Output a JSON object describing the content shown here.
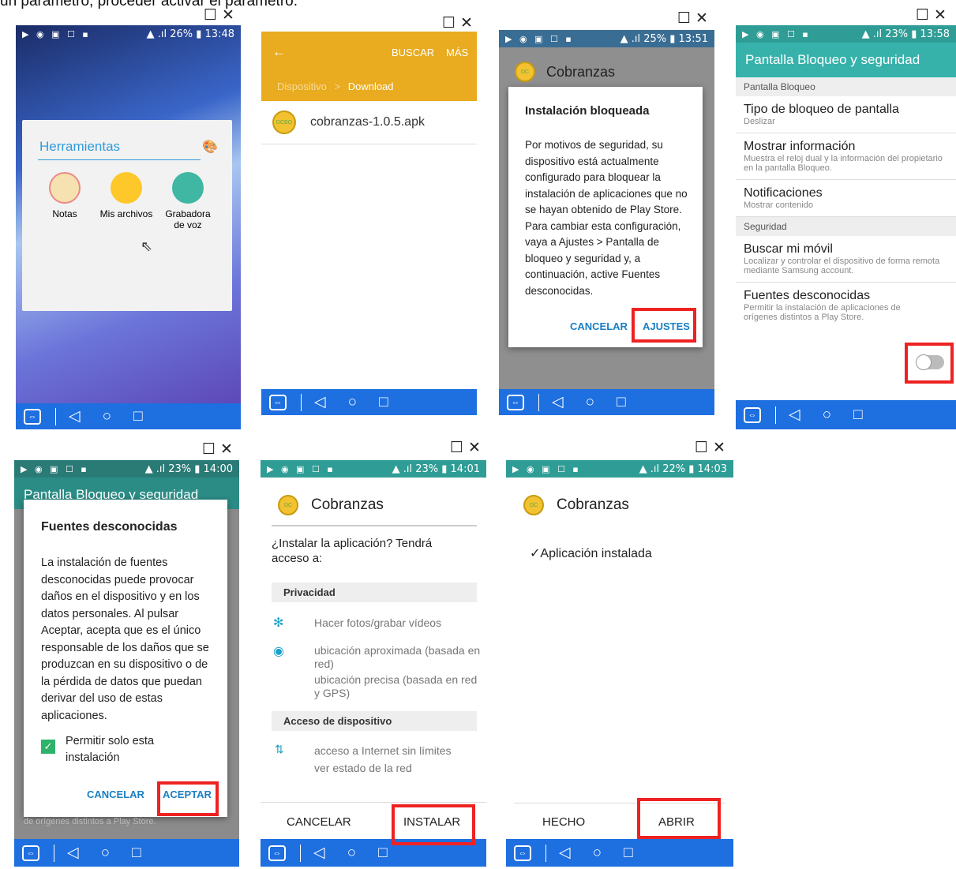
{
  "caption": "un parámetro, proceder activar el parámetro.",
  "status": {
    "p1": {
      "battery": "26%",
      "time": "13:48"
    },
    "p3": {
      "battery": "25%",
      "time": "13:51"
    },
    "p4": {
      "battery": "23%",
      "time": "13:58"
    },
    "p5": {
      "battery": "23%",
      "time": "14:00"
    },
    "p6": {
      "battery": "23%",
      "time": "14:01"
    },
    "p7": {
      "battery": "22%",
      "time": "14:03"
    }
  },
  "nav": {
    "back": "◁",
    "home": "○",
    "recent": "□"
  },
  "window_controls": "☐✕",
  "p1": {
    "folder_title": "Herramientas",
    "apps": [
      "Notas",
      "Mis archivos",
      "Grabadora de voz"
    ]
  },
  "p2": {
    "buscar": "BUSCAR",
    "mas": "MÁS",
    "breadcrumb_root": "Dispositivo",
    "breadcrumb_sep": ">",
    "breadcrumb_folder": "Download",
    "file": "cobranzas-1.0.5.apk"
  },
  "p3": {
    "app_name": "Cobranzas",
    "dialog_title": "Instalación bloqueada",
    "dialog_body": "Por motivos de seguridad, su dispositivo está actualmente configurado para bloquear la instalación de aplicaciones que no se hayan obtenido de Play Store. Para cambiar esta configuración, vaya a Ajustes > Pantalla de bloqueo y seguridad y, a continuación, active Fuentes desconocidas.",
    "cancel": "CANCELAR",
    "settings": "AJUSTES"
  },
  "p4": {
    "title": "Pantalla Bloqueo y seguridad",
    "section1": "Pantalla Bloqueo",
    "items": [
      {
        "title": "Tipo de bloqueo de pantalla",
        "sub": "Deslizar"
      },
      {
        "title": "Mostrar información",
        "sub": "Muestra el reloj dual y la información del propietario en la pantalla Bloqueo."
      },
      {
        "title": "Notificaciones",
        "sub": "Mostrar contenido"
      }
    ],
    "section2": "Seguridad",
    "items2": [
      {
        "title": "Buscar mi móvil",
        "sub": "Localizar y controlar el dispositivo de forma remota mediante Samsung account."
      },
      {
        "title": "Fuentes desconocidas",
        "sub": "Permitir la instalación de aplicaciones de orígenes distintos a Play Store."
      }
    ]
  },
  "p5": {
    "bg_title": "Pantalla Bloqueo y seguridad",
    "dialog_title": "Fuentes desconocidas",
    "dialog_body": "La instalación de fuentes desconocidas puede provocar daños en el dispositivo y en los datos personales. Al pulsar Aceptar, acepta que es el único responsable de los daños que se produzcan en su dispositivo o de la pérdida de datos que puedan derivar del uso de estas aplicaciones.",
    "checkbox": "Permitir solo esta instalación",
    "cancel": "CANCELAR",
    "accept": "ACEPTAR",
    "bg_footer": "de orígenes distintos a Play Store."
  },
  "p6": {
    "app_name": "Cobranzas",
    "question": "¿Instalar la aplicación? Tendrá acceso a:",
    "section1": "Privacidad",
    "perm_camera": "Hacer fotos/grabar vídeos",
    "perm_loc1": "ubicación aproximada (basada en red)",
    "perm_loc2": "ubicación precisa (basada en red y GPS)",
    "section2": "Acceso de dispositivo",
    "perm_net1": "acceso a Internet sin límites",
    "perm_net2": "ver estado de la red",
    "cancel": "CANCELAR",
    "install": "INSTALAR"
  },
  "p7": {
    "app_name": "Cobranzas",
    "installed": "Aplicación instalada",
    "done": "HECHO",
    "open": "ABRIR"
  }
}
